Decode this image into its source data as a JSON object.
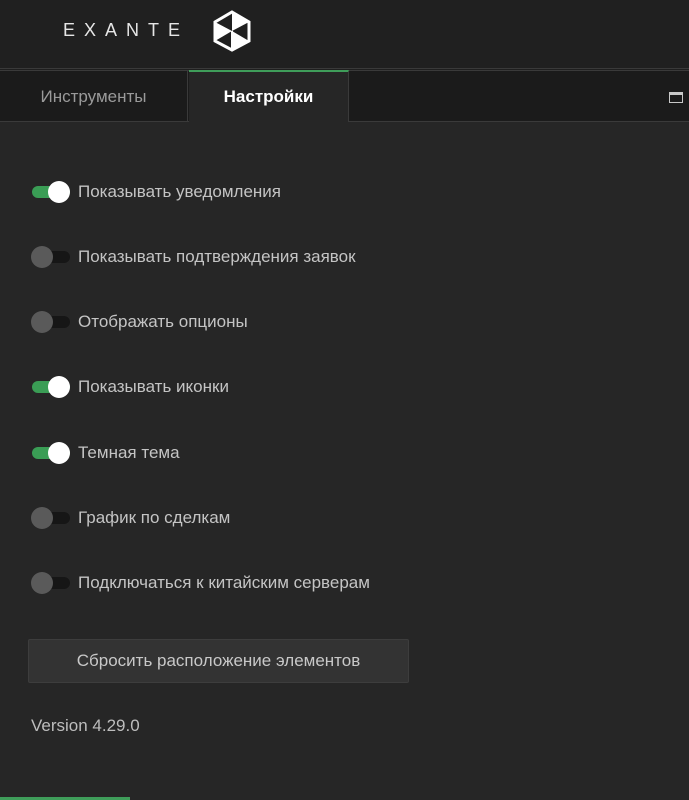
{
  "header": {
    "brand": "EXANTE"
  },
  "tabs": [
    {
      "label": "Инструменты",
      "active": false
    },
    {
      "label": "Настройки",
      "active": true
    }
  ],
  "settings": {
    "items": [
      {
        "label": "Показывать уведомления",
        "enabled": true
      },
      {
        "label": "Показывать подтверждения заявок",
        "enabled": false
      },
      {
        "label": "Отображать опционы",
        "enabled": false
      },
      {
        "label": "Показывать иконки",
        "enabled": true
      },
      {
        "label": "Темная тема",
        "enabled": true
      },
      {
        "label": "График по сделкам",
        "enabled": false
      },
      {
        "label": "Подключаться к китайским серверам",
        "enabled": false
      }
    ],
    "reset_label": "Сбросить расположение элементов",
    "version": "Version 4.29.0"
  },
  "colors": {
    "accent": "#3a9d55",
    "background": "#262626",
    "header_background": "#202020"
  },
  "icons": {
    "logo": "exante-logo-icon",
    "maximize": "maximize-icon"
  }
}
